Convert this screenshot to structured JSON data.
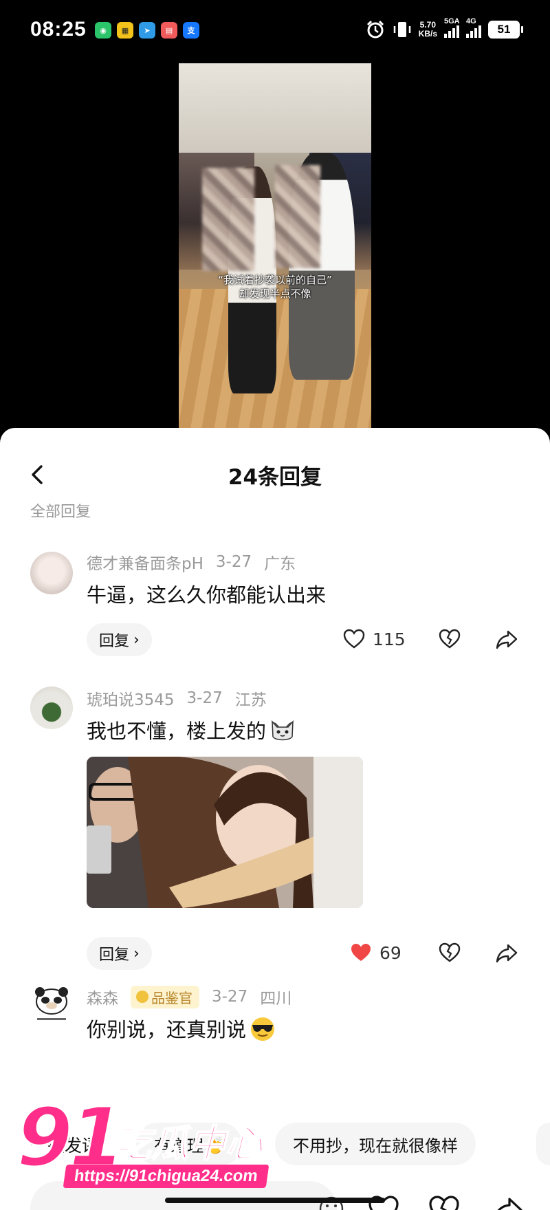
{
  "status_bar": {
    "time": "08:25",
    "net_speed": "5.70",
    "net_unit": "KB/s",
    "sig1_label": "5GA",
    "sig2_label": "4G",
    "battery": "51"
  },
  "video": {
    "caption_line1": "“我试着抄袭以前的自己”",
    "caption_line2": "却发现半点不像"
  },
  "sheet": {
    "title": "24条回复",
    "all_replies": "全部回复"
  },
  "comments": [
    {
      "user": "德才兼备面条pH",
      "date": "3-27",
      "location": "广东",
      "text": "牛逼，这么久你都能认出来",
      "reply_label": "回复",
      "likes": "115",
      "liked": false
    },
    {
      "user": "琥珀说3545",
      "date": "3-27",
      "location": "江苏",
      "text": "我也不懂，楼上发的",
      "reply_label": "回复",
      "likes": "69",
      "liked": true
    },
    {
      "user": "森森",
      "badge": "品鉴官",
      "date": "3-27",
      "location": "四川",
      "text": "你别说，还真别说"
    }
  ],
  "quick_reply": {
    "label": "一键发评",
    "chips": [
      "有道理👏",
      "不用抄，现在就很像样"
    ]
  },
  "watermark": {
    "brand_number": "91",
    "brand_name": "吃瓜中心",
    "url": "https://91chigua24.com"
  },
  "colors": {
    "like_red": "#f04646",
    "brand_pink": "#ff2e8a"
  }
}
